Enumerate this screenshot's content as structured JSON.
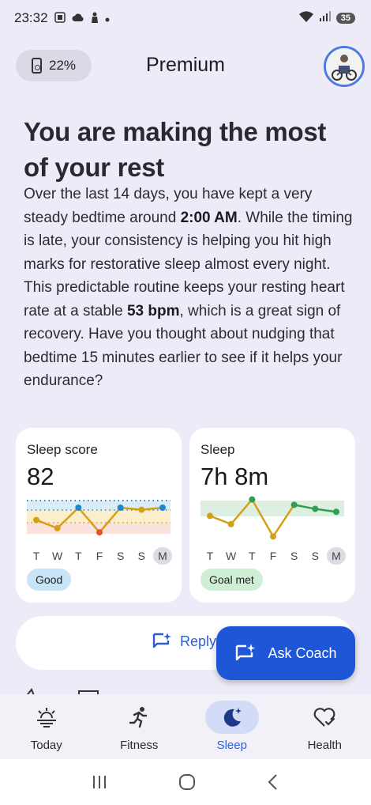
{
  "status_bar": {
    "time": "23:32",
    "battery": "35"
  },
  "header": {
    "battery_chip": "22%",
    "title": "Premium",
    "icons": {
      "device_battery": "phone-battery-icon",
      "avatar": "profile-avatar"
    }
  },
  "main": {
    "headline": "You are making the most of your rest",
    "paragraph1": {
      "part1": "Over the last 14 days, you have kept a very steady bedtime around ",
      "bold1": "2:00 AM",
      "part2": ". While the timing is late, your consistency is helping you hit high marks for restorative sleep almost every night."
    },
    "paragraph2": {
      "part1": "This predictable routine keeps your resting heart rate at a stable ",
      "bold1": "53 bpm",
      "part2": ", which is a great sign of recovery. Have you thought about nudging that bedtime 15 minutes earlier to see if it helps your endurance?"
    }
  },
  "cards": {
    "sleep_score": {
      "title": "Sleep score",
      "value": "82",
      "badge": "Good",
      "days": [
        "T",
        "W",
        "T",
        "F",
        "S",
        "S",
        "M"
      ]
    },
    "sleep": {
      "title": "Sleep",
      "value": "7h 8m",
      "badge": "Goal met",
      "days": [
        "T",
        "W",
        "T",
        "F",
        "S",
        "S",
        "M"
      ]
    }
  },
  "chart_data": [
    {
      "type": "line",
      "categories": [
        "T",
        "W",
        "T",
        "F",
        "S",
        "S",
        "M"
      ],
      "values": [
        0.45,
        0.25,
        0.75,
        0.15,
        0.75,
        0.7,
        0.75
      ],
      "point_colors": [
        "#d4a017",
        "#d4a017",
        "#1e88c8",
        "#e0532e",
        "#1e88c8",
        "#d4a017",
        "#1e88c8"
      ]
    },
    {
      "type": "line",
      "categories": [
        "T",
        "W",
        "T",
        "F",
        "S",
        "S",
        "M"
      ],
      "values": [
        0.55,
        0.35,
        0.95,
        0.05,
        0.82,
        0.72,
        0.65
      ],
      "point_colors": [
        "#d4a017",
        "#d4a017",
        "#2e9e4f",
        "#d4a017",
        "#2e9e4f",
        "#2e9e4f",
        "#2e9e4f"
      ]
    }
  ],
  "actions": {
    "reply": "Reply",
    "ask_coach": "Ask Coach"
  },
  "bottom_nav": {
    "items": [
      {
        "label": "Today",
        "icon": "sunrise-icon"
      },
      {
        "label": "Fitness",
        "icon": "running-icon"
      },
      {
        "label": "Sleep",
        "icon": "moon-icon"
      },
      {
        "label": "Health",
        "icon": "heart-check-icon"
      }
    ],
    "active": "Sleep"
  },
  "colors": {
    "accent": "#2b5fd4",
    "fab": "#1d57d8",
    "background": "#eeebf8"
  }
}
